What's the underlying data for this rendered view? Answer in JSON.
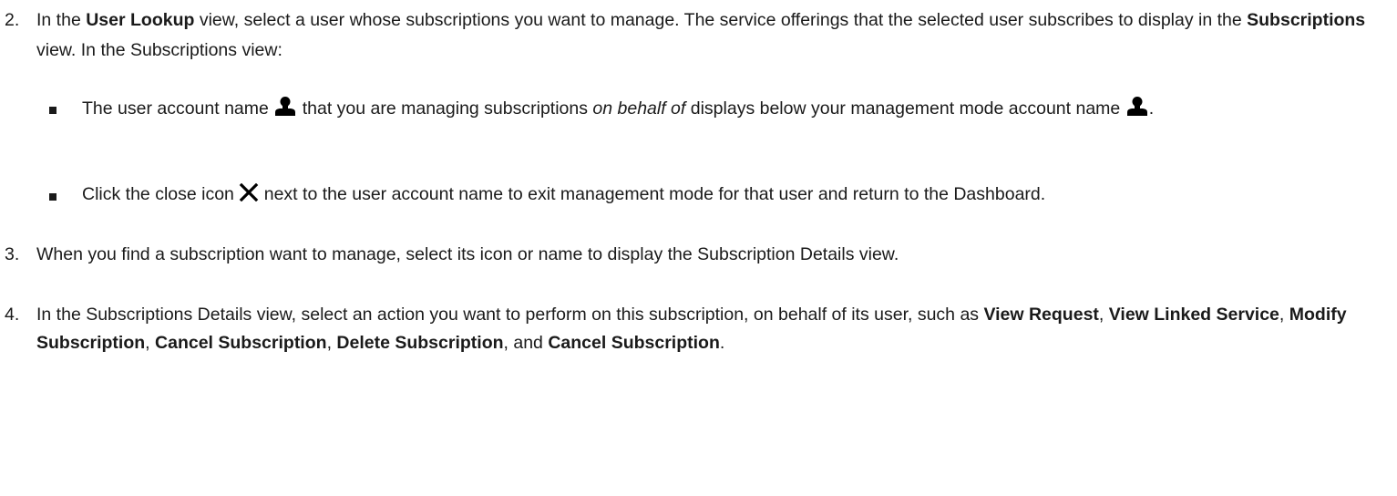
{
  "steps": [
    {
      "number": "2.",
      "t1": "In the ",
      "b1": "User Lookup",
      "t2": " view, select a user whose subscriptions you want to manage. The service offerings that the selected user subscribes to display in the ",
      "b2": "Subscriptions",
      "t3": " view. In the Subscriptions view:",
      "bullets": [
        {
          "t1": "The user account name ",
          "icon1": "user-icon",
          "t2": " that you are managing subscriptions ",
          "i1": "on behalf of",
          "t3": " displays below your management mode account name ",
          "icon2": "user-icon",
          "t4": "."
        },
        {
          "t1": "Click the close icon ",
          "icon1": "close-icon",
          "t2": " next to the user account name to exit management mode for that user and return to the Dashboard."
        }
      ]
    },
    {
      "number": "3.",
      "t1": "When you find a subscription want to manage, select its icon or name to display the Subscription Details view."
    },
    {
      "number": "4.",
      "t1": "In the Subscriptions Details view, select an action you want to perform on this subscription, on behalf of its user, such as ",
      "b1": "View Request",
      "t2": ", ",
      "b2": "View Linked Service",
      "t3": ", ",
      "b3": "Modify Subscription",
      "t4": ", ",
      "b4": "Cancel Subscription",
      "t5": ", ",
      "b5": "Delete Subscription",
      "t6": ", and ",
      "b6": "Cancel Subscription",
      "t7": "."
    }
  ]
}
